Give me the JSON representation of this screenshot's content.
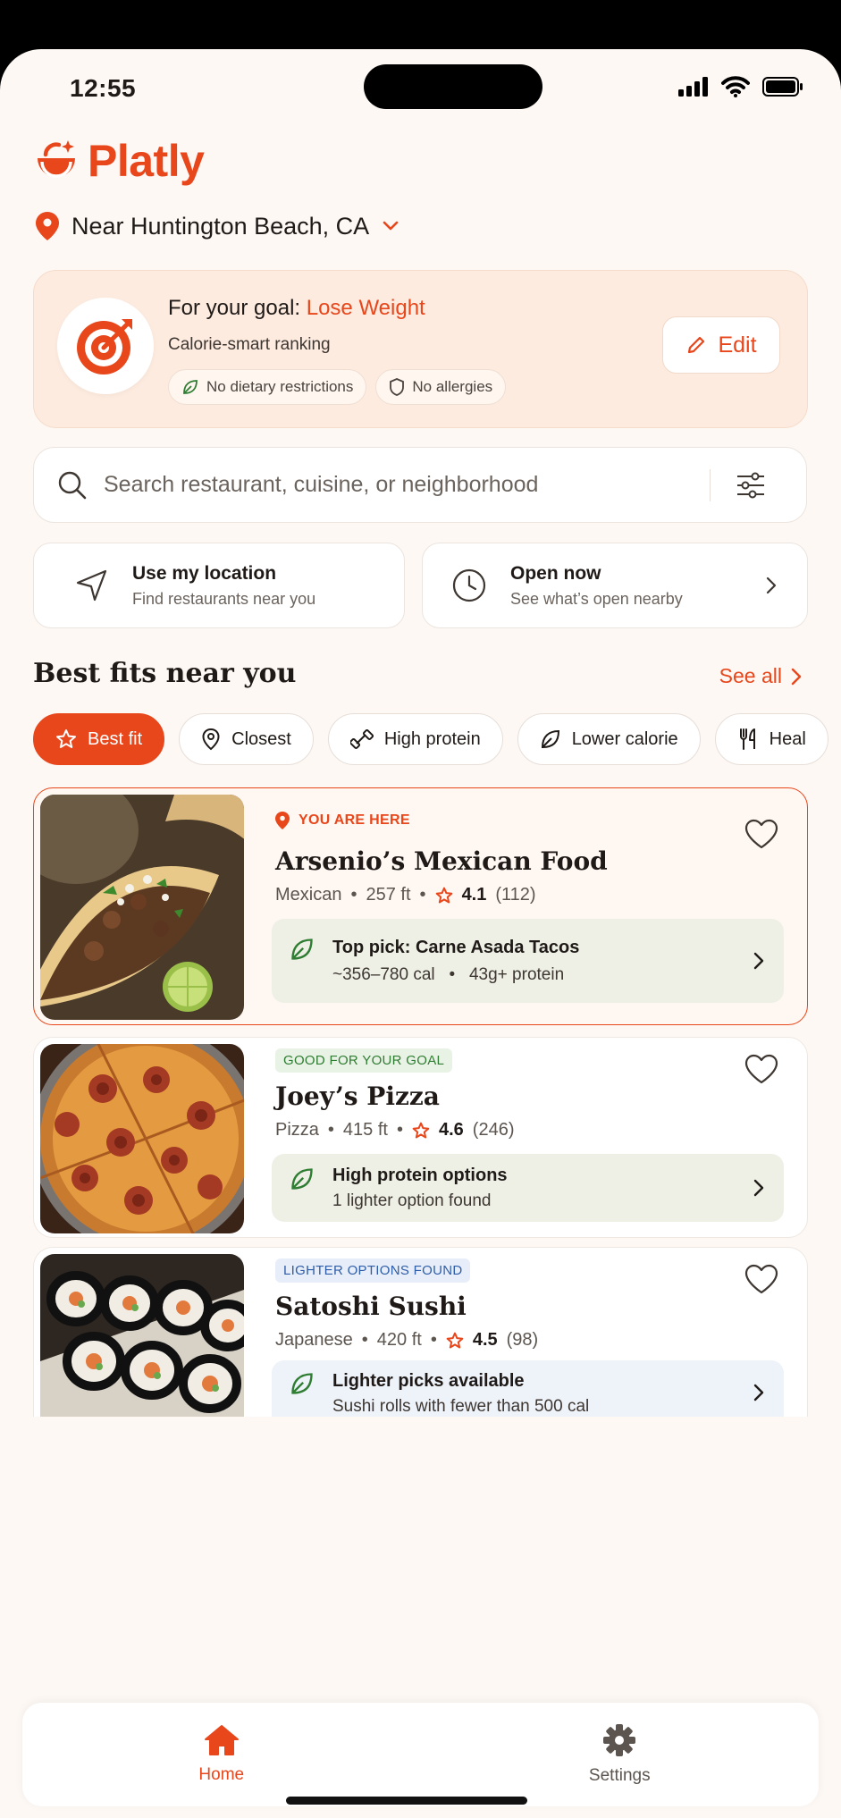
{
  "status": {
    "time": "12:55"
  },
  "app": {
    "name": "Platly",
    "accent": "#e8471c"
  },
  "location": {
    "label": "Near Huntington Beach, CA"
  },
  "goal": {
    "prefix": "For your goal: ",
    "goal_name": "Lose Weight",
    "subtitle": "Calorie-smart ranking",
    "chips": [
      "No dietary restrictions",
      "No allergies"
    ],
    "edit_label": "Edit"
  },
  "search": {
    "placeholder": "Search restaurant, cuisine, or neighborhood"
  },
  "quick_actions": [
    {
      "title": "Use my location",
      "subtitle": "Find restaurants near you"
    },
    {
      "title": "Open now",
      "subtitle": "See what’s open nearby"
    }
  ],
  "section": {
    "title": "Best fits near you",
    "see_all": "See all"
  },
  "filters": [
    {
      "label": "Best fit",
      "icon": "star-icon",
      "active": true
    },
    {
      "label": "Closest",
      "icon": "location-pin-icon"
    },
    {
      "label": "High protein",
      "icon": "dumbbell-icon"
    },
    {
      "label": "Lower calorie",
      "icon": "leaf-icon"
    },
    {
      "label": "Heal",
      "icon": "utensils-icon"
    }
  ],
  "restaurants": [
    {
      "tag": "YOU ARE HERE",
      "name": "Arsenio’s Mexican Food",
      "cuisine": "Mexican",
      "distance": "257 ft",
      "rating": "4.1",
      "reviews": "(112)",
      "pick_title": "Top pick: Carne Asada Tacos",
      "pick_cal": "~356–780 cal",
      "pick_protein": "43g+ protein",
      "photo": "tacos"
    },
    {
      "tag": "GOOD FOR YOUR GOAL",
      "name": "Joey’s Pizza",
      "cuisine": "Pizza",
      "distance": "415 ft",
      "rating": "4.6",
      "reviews": "(246)",
      "pick_title": "High protein options",
      "pick_sub": "1 lighter option found",
      "photo": "pizza"
    },
    {
      "tag": "LIGHTER OPTIONS FOUND",
      "name": "Satoshi Sushi",
      "cuisine": "Japanese",
      "distance": "420 ft",
      "rating": "4.5",
      "reviews": "(98)",
      "pick_title": "Lighter picks available",
      "pick_sub": "Sushi rolls with fewer than 500 cal",
      "photo": "sushi"
    }
  ],
  "tabs": [
    {
      "label": "Home",
      "icon": "home-icon",
      "active": true
    },
    {
      "label": "Settings",
      "icon": "gear-icon",
      "active": false
    }
  ],
  "dot": "•"
}
